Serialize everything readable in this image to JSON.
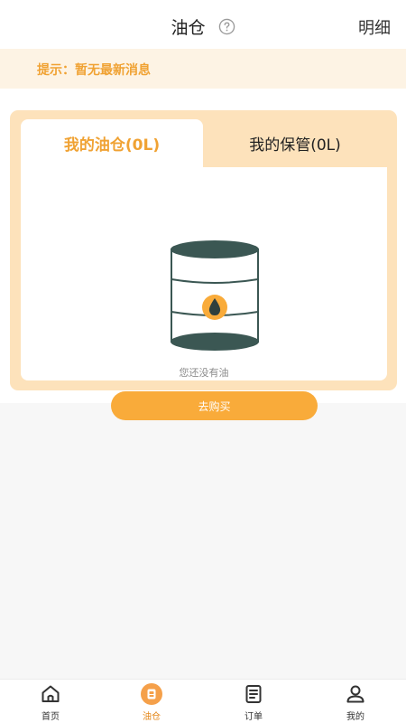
{
  "header": {
    "title": "油仓",
    "detail_label": "明细",
    "help_icon": "question-circle-icon"
  },
  "notice": {
    "text": "提示：暂无最新消息"
  },
  "card": {
    "tabs": [
      {
        "label": "我的油仓(0L)",
        "active": true
      },
      {
        "label": "我的保管(0L)",
        "active": false
      }
    ],
    "empty_icon": "oil-barrel-icon",
    "empty_text": "您还没有油",
    "buy_label": "去购买"
  },
  "tabbar": {
    "items": [
      {
        "label": "首页",
        "icon": "home-icon",
        "active": false
      },
      {
        "label": "油仓",
        "icon": "oil-tank-icon",
        "active": true
      },
      {
        "label": "订单",
        "icon": "order-list-icon",
        "active": false
      },
      {
        "label": "我的",
        "icon": "profile-icon",
        "active": false
      }
    ]
  },
  "colors": {
    "accent": "#f0a233",
    "button": "#f9ab3a",
    "card_bg": "#fde2bb",
    "notice_bg": "#fdf3e4",
    "barrel": "#3b5753",
    "tab_active": "#e58a1f"
  }
}
